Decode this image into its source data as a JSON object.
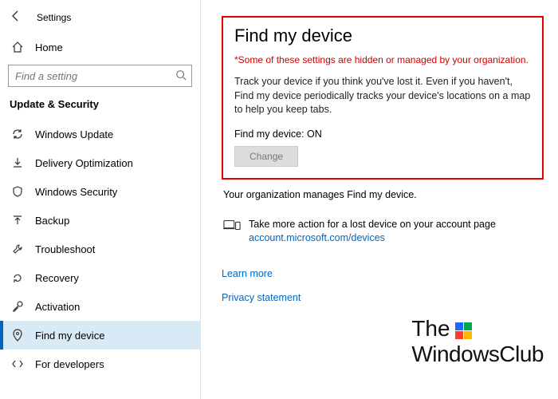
{
  "header": {
    "title": "Settings"
  },
  "home": {
    "label": "Home"
  },
  "search": {
    "placeholder": "Find a setting"
  },
  "breadcrumb": "Update & Security",
  "nav": [
    {
      "label": "Windows Update"
    },
    {
      "label": "Delivery Optimization"
    },
    {
      "label": "Windows Security"
    },
    {
      "label": "Backup"
    },
    {
      "label": "Troubleshoot"
    },
    {
      "label": "Recovery"
    },
    {
      "label": "Activation"
    },
    {
      "label": "Find my device"
    },
    {
      "label": "For developers"
    }
  ],
  "main": {
    "title": "Find my device",
    "warning": "*Some of these settings are hidden or managed by your organization.",
    "description": "Track your device if you think you've lost it. Even if you haven't, Find my device periodically tracks your device's locations on a map to help you keep tabs.",
    "status": "Find my device: ON",
    "change_button": "Change",
    "org_note": "Your organization manages Find my device.",
    "action_text": "Take more action for a lost device on your account page",
    "action_link": "account.microsoft.com/devices",
    "learn_more": "Learn more",
    "privacy": "Privacy statement"
  },
  "watermark": {
    "line1": "The",
    "line2": "WindowsClub"
  }
}
